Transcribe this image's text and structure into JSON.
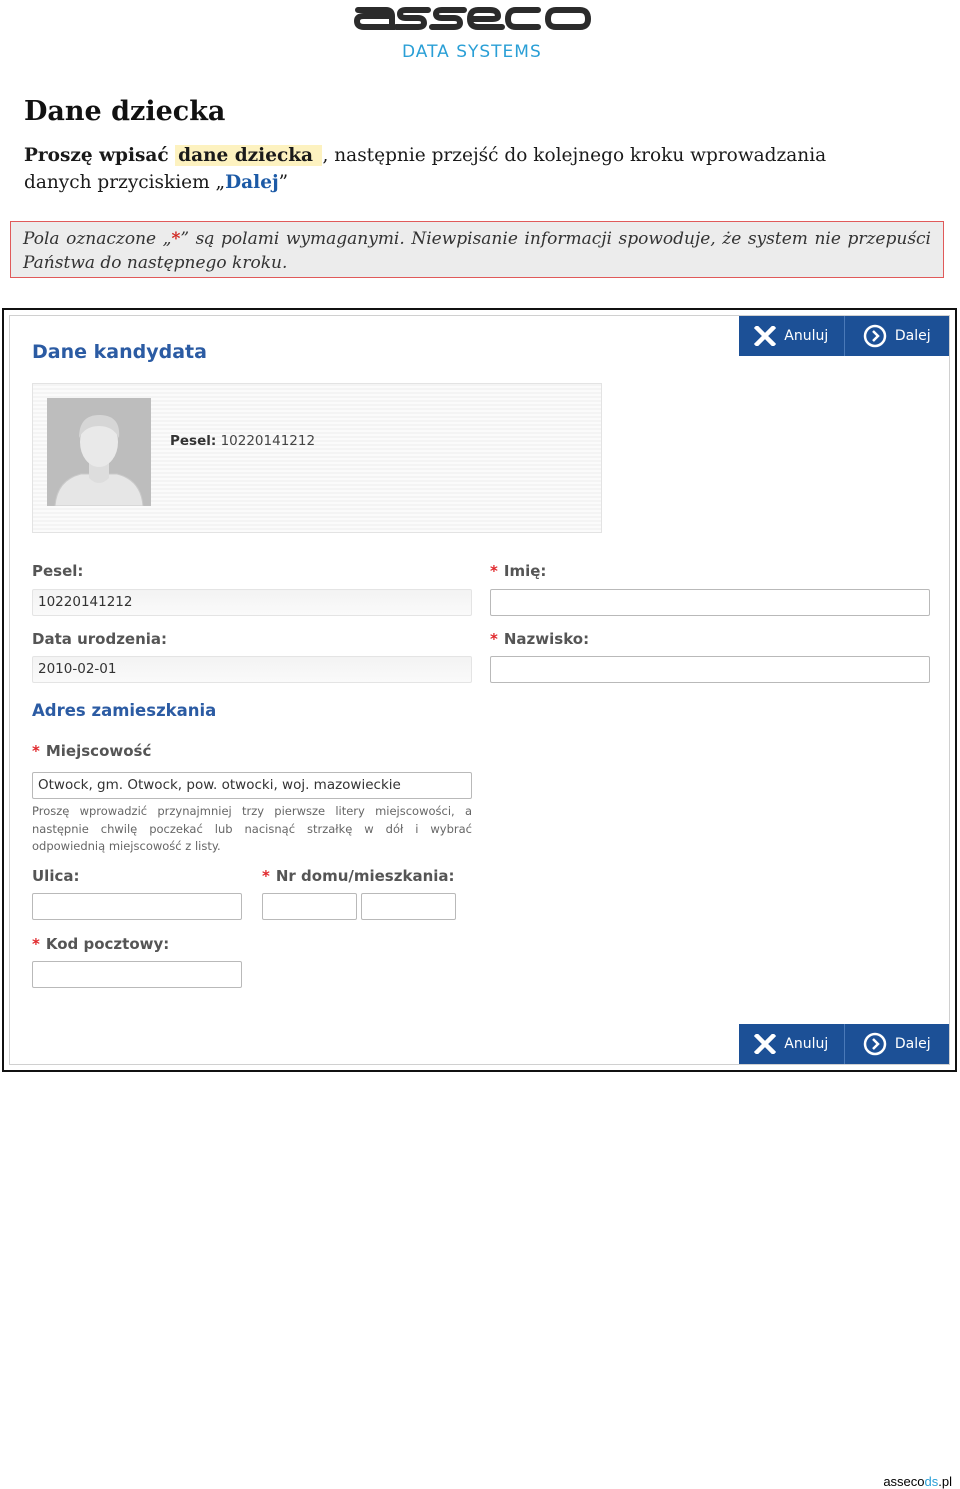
{
  "logo": {
    "wordmark": "asseco",
    "subtitle": "DATA SYSTEMS"
  },
  "doc": {
    "title": "Dane dziecka",
    "intro_part1": "Proszę wpisać ",
    "intro_highlight": "dane dziecka ",
    "intro_part2": ", następnie przejść do kolejnego kroku wprowadzania danych przyciskiem „",
    "intro_button_word": "Dalej",
    "intro_end": "”",
    "note_part1": "Pola oznaczone „",
    "note_star": "*",
    "note_part2": "” są polami wymaganymi. Niewpisanie informacji spowoduje, że system nie przepuści Państwa do następnego kroku."
  },
  "form": {
    "buttons": {
      "cancel": "Anuluj",
      "next": "Dalej"
    },
    "section_title": "Dane kandydata",
    "card": {
      "pesel_label": "Pesel:",
      "pesel_value": "10220141212"
    },
    "fields": {
      "pesel_label": "Pesel:",
      "pesel_value": "10220141212",
      "dob_label": "Data urodzenia:",
      "dob_value": "2010-02-01",
      "first_name_label": "Imię:",
      "first_name_value": "",
      "last_name_label": "Nazwisko:",
      "last_name_value": "",
      "required_mark": "*"
    },
    "address": {
      "title": "Adres zamieszkania",
      "city_label": "Miejscowość",
      "city_value": "Otwock, gm. Otwock, pow. otwocki, woj. mazowieckie",
      "city_hint": "Proszę wprowadzić przynajmniej trzy pierwsze litery miejscowości, a następnie chwilę poczekać lub nacisnąć strzałkę w dół i wybrać odpowiednią miejscowość z listy.",
      "street_label": "Ulica:",
      "street_value": "",
      "house_label": "Nr domu/mieszkania:",
      "house_value": "",
      "flat_value": "",
      "postal_label": "Kod pocztowy:",
      "postal_value": ""
    }
  },
  "footer": {
    "brand_a": "asseco",
    "brand_b": "ds",
    "brand_c": ".pl"
  },
  "colors": {
    "brand_blue": "#1c5096",
    "title_blue": "#2b5ba3",
    "required_red": "#e0282c",
    "logo_cyan": "#2a9fd6"
  }
}
